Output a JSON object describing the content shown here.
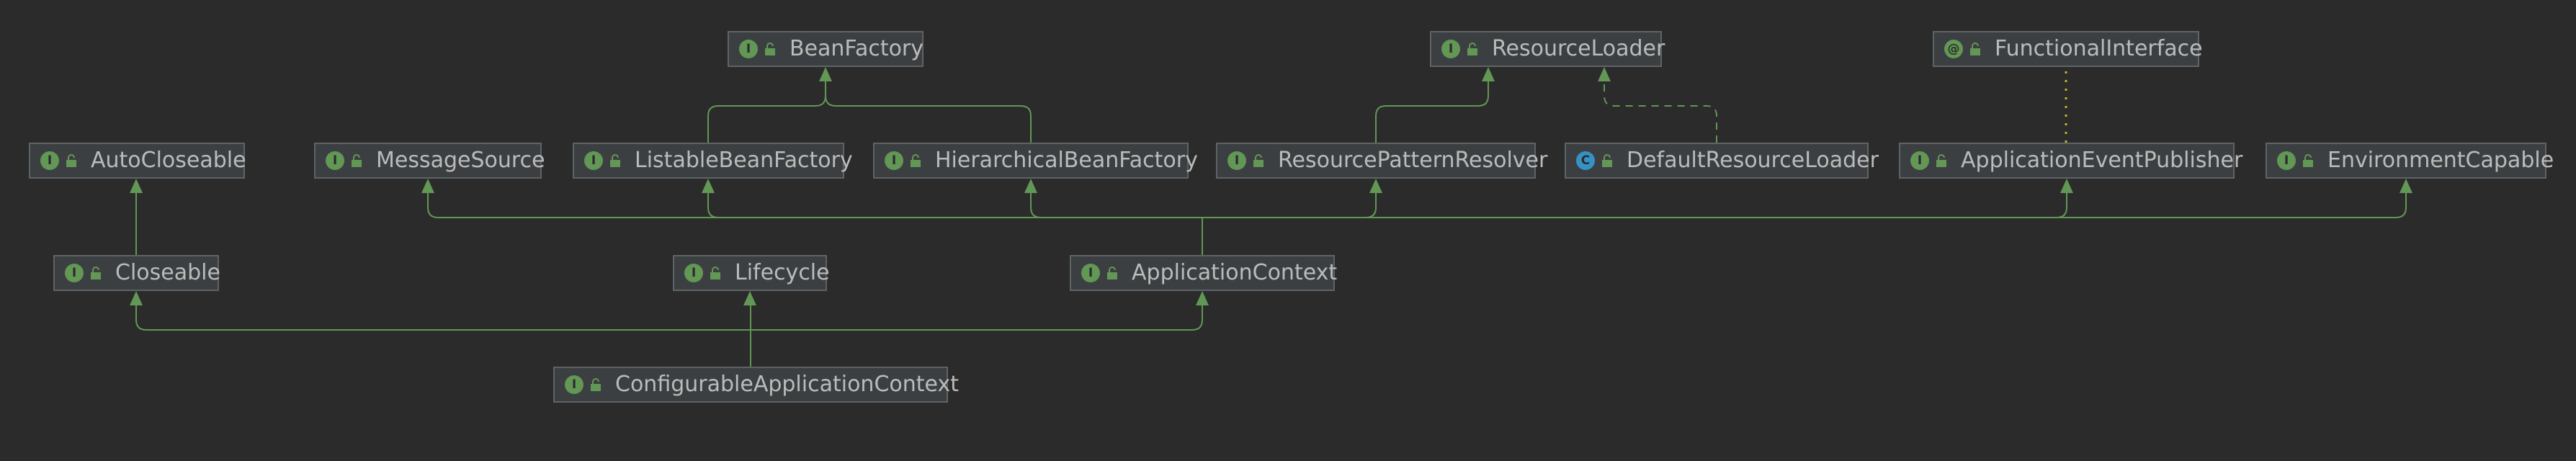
{
  "diagram": {
    "colors": {
      "background": "#2b2b2b",
      "node_fill": "#3c3f41",
      "node_border": "#5f6366",
      "text": "#bbbbbb",
      "edge": "#629755",
      "implements_edge": "#629755",
      "annotation_edge": "#bbb529",
      "interface_badge": "#629755",
      "class_badge": "#3592c4"
    },
    "nodes": {
      "bean_factory": {
        "label": "BeanFactory",
        "kind": "interface",
        "kind_glyph": "I",
        "icon": "interface-icon"
      },
      "resource_loader": {
        "label": "ResourceLoader",
        "kind": "interface",
        "kind_glyph": "I",
        "icon": "interface-icon"
      },
      "functional_interface": {
        "label": "FunctionalInterface",
        "kind": "annotation",
        "kind_glyph": "@",
        "icon": "annotation-icon"
      },
      "auto_closeable": {
        "label": "AutoCloseable",
        "kind": "interface",
        "kind_glyph": "I",
        "icon": "interface-icon"
      },
      "message_source": {
        "label": "MessageSource",
        "kind": "interface",
        "kind_glyph": "I",
        "icon": "interface-icon"
      },
      "listable_bean_factory": {
        "label": "ListableBeanFactory",
        "kind": "interface",
        "kind_glyph": "I",
        "icon": "interface-icon"
      },
      "hierarchical_bean_factory": {
        "label": "HierarchicalBeanFactory",
        "kind": "interface",
        "kind_glyph": "I",
        "icon": "interface-icon"
      },
      "resource_pattern_resolver": {
        "label": "ResourcePatternResolver",
        "kind": "interface",
        "kind_glyph": "I",
        "icon": "interface-icon"
      },
      "default_resource_loader": {
        "label": "DefaultResourceLoader",
        "kind": "class",
        "kind_glyph": "C",
        "icon": "class-icon"
      },
      "application_event_publisher": {
        "label": "ApplicationEventPublisher",
        "kind": "interface",
        "kind_glyph": "I",
        "icon": "interface-icon"
      },
      "environment_capable": {
        "label": "EnvironmentCapable",
        "kind": "interface",
        "kind_glyph": "I",
        "icon": "interface-icon"
      },
      "closeable": {
        "label": "Closeable",
        "kind": "interface",
        "kind_glyph": "I",
        "icon": "interface-icon"
      },
      "lifecycle": {
        "label": "Lifecycle",
        "kind": "interface",
        "kind_glyph": "I",
        "icon": "interface-icon"
      },
      "application_context": {
        "label": "ApplicationContext",
        "kind": "interface",
        "kind_glyph": "I",
        "icon": "interface-icon"
      },
      "configurable_application_context": {
        "label": "ConfigurableApplicationContext",
        "kind": "interface",
        "kind_glyph": "I",
        "icon": "interface-icon"
      }
    },
    "edges": [
      {
        "from": "listable_bean_factory",
        "to": "bean_factory",
        "type": "extends"
      },
      {
        "from": "hierarchical_bean_factory",
        "to": "bean_factory",
        "type": "extends"
      },
      {
        "from": "resource_pattern_resolver",
        "to": "resource_loader",
        "type": "extends"
      },
      {
        "from": "default_resource_loader",
        "to": "resource_loader",
        "type": "implements"
      },
      {
        "from": "application_event_publisher",
        "to": "functional_interface",
        "type": "annotated"
      },
      {
        "from": "closeable",
        "to": "auto_closeable",
        "type": "extends"
      },
      {
        "from": "application_context",
        "to": "message_source",
        "type": "extends"
      },
      {
        "from": "application_context",
        "to": "listable_bean_factory",
        "type": "extends"
      },
      {
        "from": "application_context",
        "to": "hierarchical_bean_factory",
        "type": "extends"
      },
      {
        "from": "application_context",
        "to": "resource_pattern_resolver",
        "type": "extends"
      },
      {
        "from": "application_context",
        "to": "application_event_publisher",
        "type": "extends"
      },
      {
        "from": "application_context",
        "to": "environment_capable",
        "type": "extends"
      },
      {
        "from": "configurable_application_context",
        "to": "closeable",
        "type": "extends"
      },
      {
        "from": "configurable_application_context",
        "to": "lifecycle",
        "type": "extends"
      },
      {
        "from": "configurable_application_context",
        "to": "application_context",
        "type": "extends"
      }
    ]
  }
}
